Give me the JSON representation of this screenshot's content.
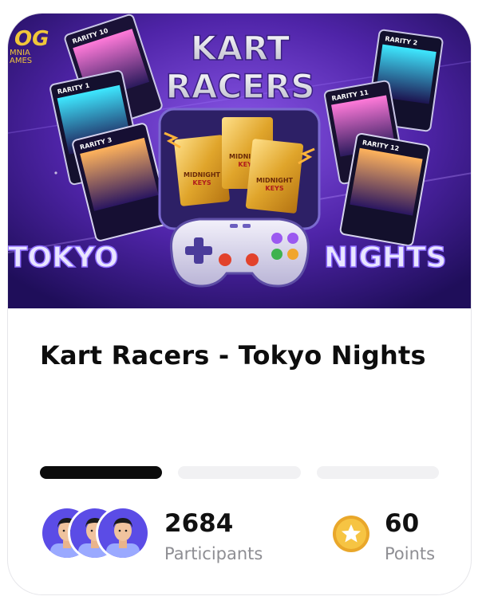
{
  "banner": {
    "publisher_logo": "OMNIA GAMES",
    "headline_line1": "KART",
    "headline_line2": "RACERS",
    "word_left": "TOKYO",
    "word_right": "NIGHTS",
    "pack_label_line1": "MIDNIGHT",
    "pack_label_line2": "KEYS",
    "cards_left": [
      "RARITY 10",
      "RARITY 1",
      "RARITY 3"
    ],
    "cards_right": [
      "RARITY 2",
      "RARITY 11",
      "RARITY 12"
    ]
  },
  "quest": {
    "title": "Kart Racers - Tokyo Nights",
    "progress_steps": 3,
    "progress_completed": 1
  },
  "stats": {
    "participants_value": "2684",
    "participants_label": "Participants",
    "points_value": "60",
    "points_label": "Points"
  },
  "icons": [
    "participant-avatar-icon",
    "star-coin-icon",
    "gamepad-icon"
  ],
  "colors": {
    "active_step": "#0b0b0b",
    "inactive_step": "#f1f1f3",
    "coin": "#f6c443",
    "banner_purple": "#5a2bb0"
  }
}
